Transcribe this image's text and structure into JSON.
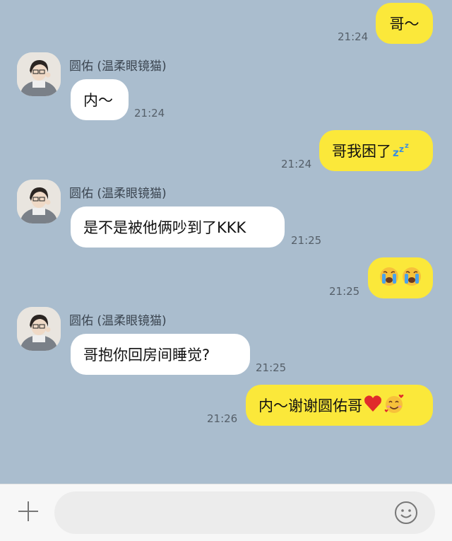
{
  "contact": {
    "name": "圆佑 (温柔眼镜猫)"
  },
  "messages": [
    {
      "side": "out",
      "text": "哥～",
      "time": "21:24"
    },
    {
      "side": "in",
      "text": "内～",
      "time": "21:24"
    },
    {
      "side": "out",
      "text": "哥我困了",
      "emoji": "sleeping-zzz",
      "time": "21:24"
    },
    {
      "side": "in",
      "text": "是不是被他俩吵到了KKK",
      "time": "21:25"
    },
    {
      "side": "out",
      "text": "",
      "emoji": "crying-faces",
      "time": "21:25"
    },
    {
      "side": "in",
      "text": "哥抱你回房间睡觉?",
      "time": "21:25"
    },
    {
      "side": "out",
      "text": "内～谢谢圆佑哥",
      "emoji": "heart-and-smiling-face-with-hearts",
      "time": "21:26"
    }
  ],
  "composer": {
    "placeholder": "",
    "add_icon": "plus-icon",
    "emoji_icon": "emoji-icon"
  },
  "colors": {
    "chat_bg": "#aabdce",
    "outgoing_bubble": "#fbe83a",
    "incoming_bubble": "#ffffff"
  }
}
